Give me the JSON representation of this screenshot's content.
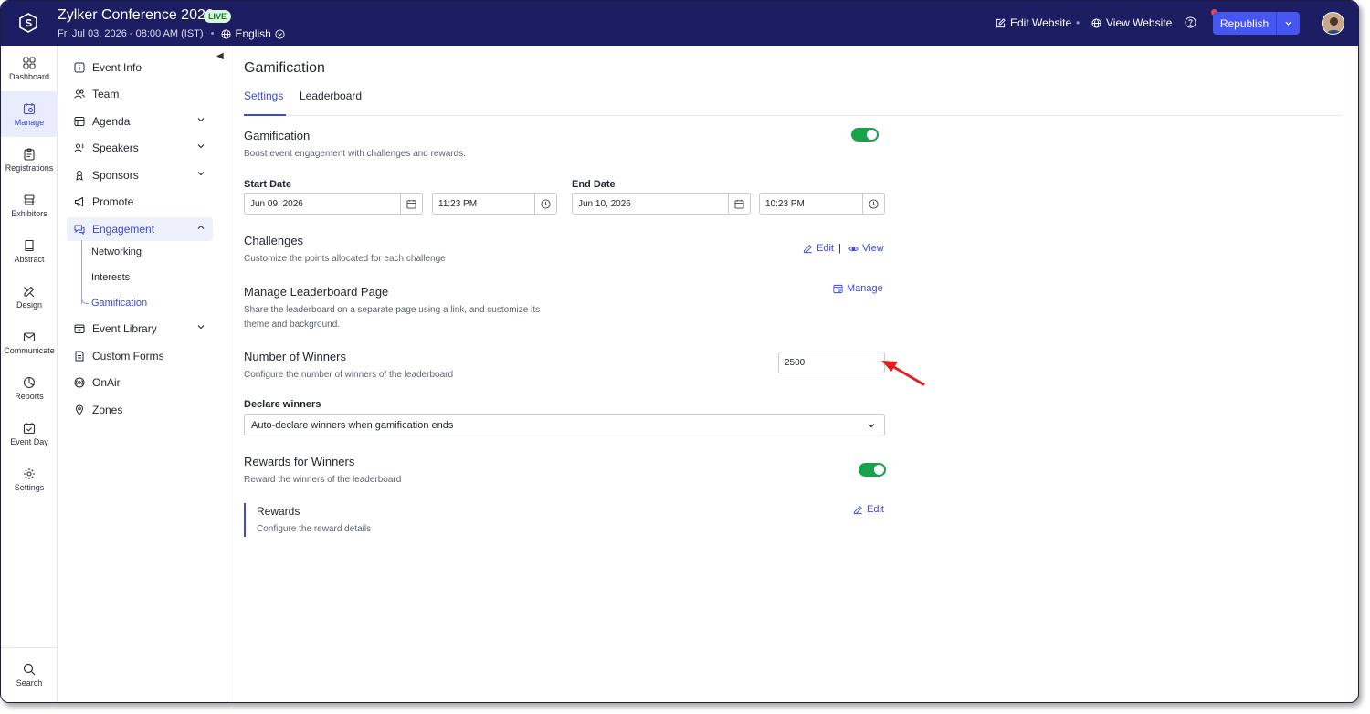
{
  "header": {
    "event_title": "Zylker Conference 2026",
    "live_label": "LIVE",
    "datetime": "Fri Jul 03, 2026 - 08:00 AM (IST)",
    "language": "English",
    "edit_website": "Edit Website",
    "view_website": "View Website",
    "republish": "Republish"
  },
  "rail": {
    "items": [
      {
        "label": "Dashboard",
        "icon": "grid-icon"
      },
      {
        "label": "Manage",
        "icon": "calendar-gear-icon"
      },
      {
        "label": "Registrations",
        "icon": "clipboard-icon"
      },
      {
        "label": "Exhibitors",
        "icon": "booth-icon"
      },
      {
        "label": "Abstract",
        "icon": "book-icon"
      },
      {
        "label": "Design",
        "icon": "pen-ruler-icon"
      },
      {
        "label": "Communicate",
        "icon": "mail-icon"
      },
      {
        "label": "Reports",
        "icon": "pie-chart-icon"
      },
      {
        "label": "Event Day",
        "icon": "calendar-check-icon"
      },
      {
        "label": "Settings",
        "icon": "gear-icon"
      }
    ],
    "search": "Search"
  },
  "subnav": {
    "items": [
      {
        "label": "Event Info"
      },
      {
        "label": "Team"
      },
      {
        "label": "Agenda"
      },
      {
        "label": "Speakers"
      },
      {
        "label": "Sponsors"
      },
      {
        "label": "Promote"
      },
      {
        "label": "Engagement"
      }
    ],
    "engagement_children": [
      "Networking",
      "Interests",
      "Gamification"
    ],
    "items_after": [
      {
        "label": "Event Library"
      },
      {
        "label": "Custom Forms"
      },
      {
        "label": "OnAir"
      },
      {
        "label": "Zones"
      }
    ]
  },
  "main": {
    "title": "Gamification",
    "tabs": [
      "Settings",
      "Leaderboard"
    ],
    "gamification": {
      "title": "Gamification",
      "desc": "Boost event engagement with challenges and rewards."
    },
    "start_date_label": "Start Date",
    "start_date": "Jun 09, 2026",
    "start_time": "11:23 PM",
    "end_date_label": "End Date",
    "end_date": "Jun 10, 2026",
    "end_time": "10:23 PM",
    "challenges": {
      "title": "Challenges",
      "desc": "Customize the points allocated for each challenge",
      "edit": "Edit",
      "sep": "|",
      "view": "View"
    },
    "leaderboard_page": {
      "title": "Manage Leaderboard Page",
      "desc": "Share the leaderboard on a separate page using a link, and customize its theme and background.",
      "manage": "Manage"
    },
    "winners": {
      "title": "Number of Winners",
      "desc": "Configure the number of winners of the leaderboard",
      "value": "2500"
    },
    "declare": {
      "label": "Declare winners",
      "selected": "Auto-declare winners when gamification ends"
    },
    "rewards_for_winners": {
      "title": "Rewards for Winners",
      "desc": "Reward the winners of the leaderboard"
    },
    "rewards": {
      "title": "Rewards",
      "desc": "Configure the reward details",
      "edit": "Edit"
    }
  },
  "colors": {
    "header_bg": "#1d1d63",
    "accent": "#3c4ad6",
    "toggle_on": "#16a34a",
    "annotation_arrow": "#e02020"
  }
}
